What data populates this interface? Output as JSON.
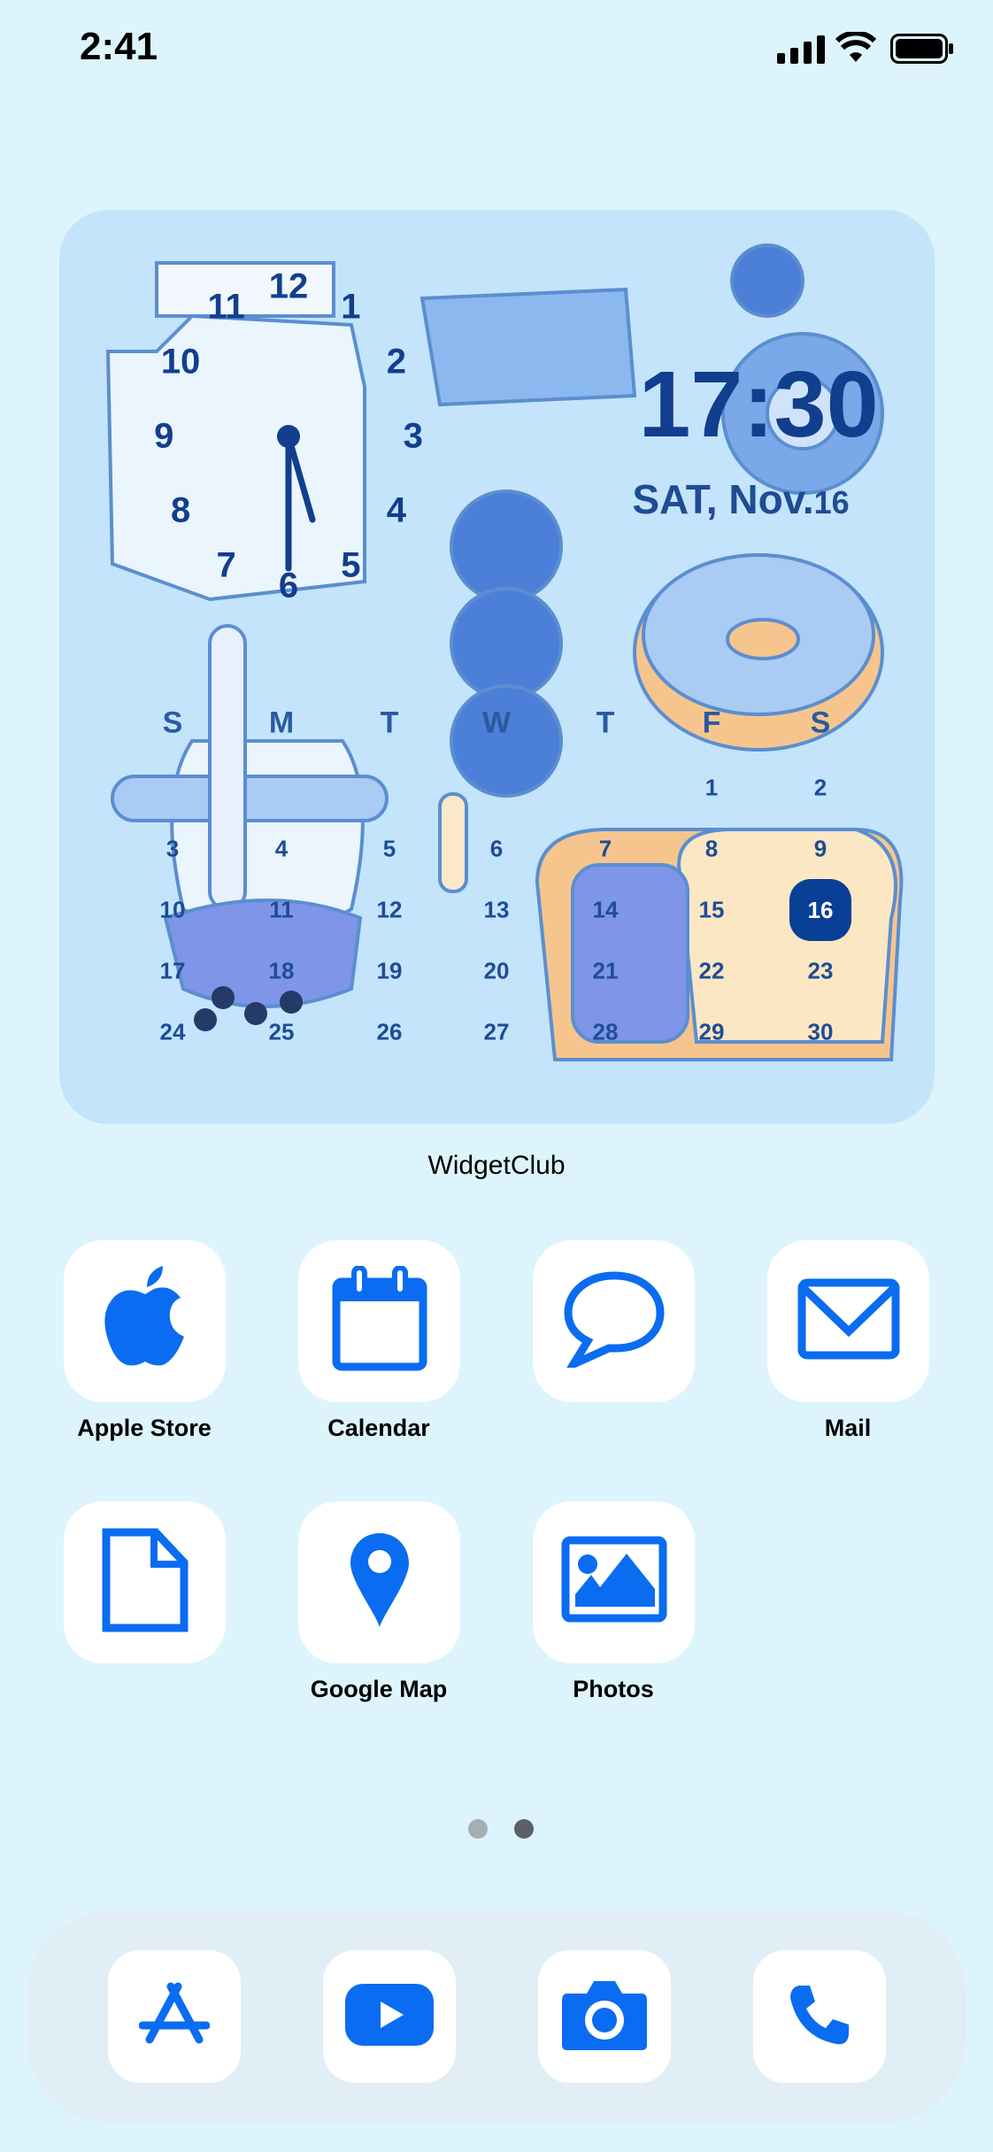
{
  "status_bar": {
    "time": "2:41",
    "icons": [
      "signal-icon",
      "wifi-icon",
      "battery-icon"
    ]
  },
  "widget": {
    "clock_numbers": [
      "12",
      "1",
      "2",
      "3",
      "4",
      "5",
      "6",
      "7",
      "8",
      "9",
      "10",
      "11"
    ],
    "clock_time": "17:30",
    "date_prefix": "SAT, Nov.",
    "date_day": "16",
    "weekdays": [
      "S",
      "M",
      "T",
      "W",
      "T",
      "F",
      "S"
    ],
    "weeks": [
      [
        "",
        "",
        "",
        "",
        "",
        "1",
        "2"
      ],
      [
        "3",
        "4",
        "5",
        "6",
        "7",
        "8",
        "9"
      ],
      [
        "10",
        "11",
        "12",
        "13",
        "14",
        "15",
        "16"
      ],
      [
        "17",
        "18",
        "19",
        "20",
        "21",
        "22",
        "23"
      ],
      [
        "24",
        "25",
        "26",
        "27",
        "28",
        "29",
        "30"
      ]
    ],
    "today": "16",
    "label": "WidgetClub"
  },
  "apps": [
    {
      "label": "Apple Store",
      "icon": "apple-icon"
    },
    {
      "label": "Calendar",
      "icon": "calendar-icon"
    },
    {
      "label": "",
      "icon": "message-icon"
    },
    {
      "label": "Mail",
      "icon": "mail-icon"
    },
    {
      "label": "",
      "icon": "document-icon"
    },
    {
      "label": "Google Map",
      "icon": "map-pin-icon"
    },
    {
      "label": "Photos",
      "icon": "photo-icon"
    }
  ],
  "page_indicator": {
    "pages": 2,
    "current": 2
  },
  "dock": [
    {
      "icon": "app-store-icon"
    },
    {
      "icon": "youtube-icon"
    },
    {
      "icon": "camera-icon"
    },
    {
      "icon": "phone-icon"
    }
  ],
  "colors": {
    "accent": "#0a6cf0",
    "background": "#ddf4fd",
    "widget": "#c3e4fa",
    "text_dark": "#123e8e"
  }
}
